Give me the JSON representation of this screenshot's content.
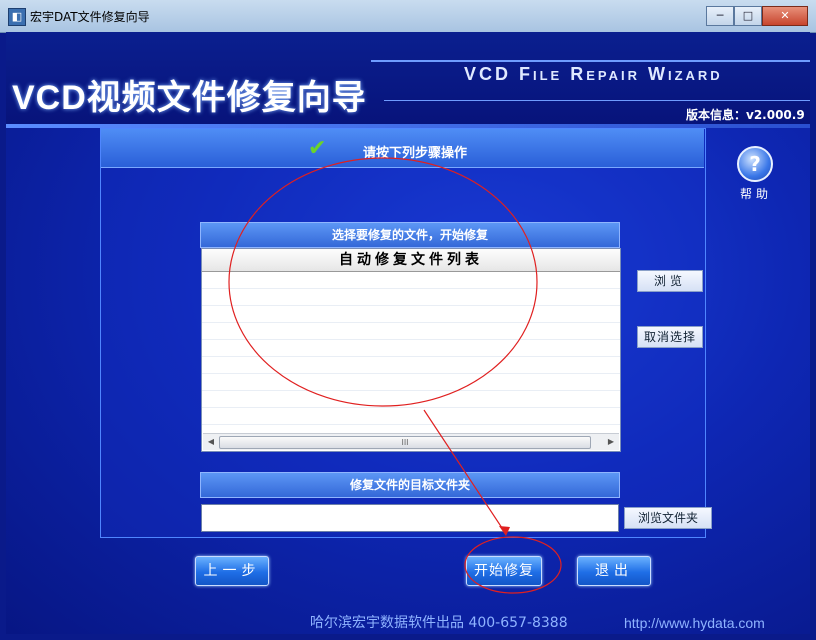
{
  "window": {
    "title": "宏宇DAT文件修复向导",
    "minimize": "─",
    "maximize": "□",
    "close": "✕",
    "app_icon": "app-icon"
  },
  "header": {
    "title_cn": "VCD视频文件修复向导",
    "title_en": "VCD File Repair Wizard",
    "version": "版本信息：v2.000.9"
  },
  "panel": {
    "heading": "请按下列步骤操作",
    "check_icon": "✔"
  },
  "help": {
    "icon": "?",
    "label": "帮助"
  },
  "file_section": {
    "bar_label": "选择要修复的文件，开始修复",
    "list_header": "自动修复文件列表",
    "rows": [
      "",
      "",
      "",
      "",
      "",
      "",
      "",
      "",
      "",
      ""
    ],
    "scroll_left": "◀",
    "scroll_right": "▶",
    "scroll_thumb": "III"
  },
  "side_buttons": {
    "browse": "浏览",
    "deselect": "取消选择"
  },
  "target_section": {
    "bar_label": "修复文件的目标文件夹",
    "folder_value": "",
    "browse_folder": "浏览文件夹"
  },
  "bottom_buttons": {
    "prev": "上一步",
    "start": "开始修复",
    "exit": "退出"
  },
  "footer": {
    "company": "哈尔滨宏宇数据软件出品  400-657-8388",
    "url": "http://www.hydata.com"
  },
  "colors": {
    "bg": "#0e27b4",
    "accent": "#3468d8",
    "annotation": "#e02020"
  }
}
